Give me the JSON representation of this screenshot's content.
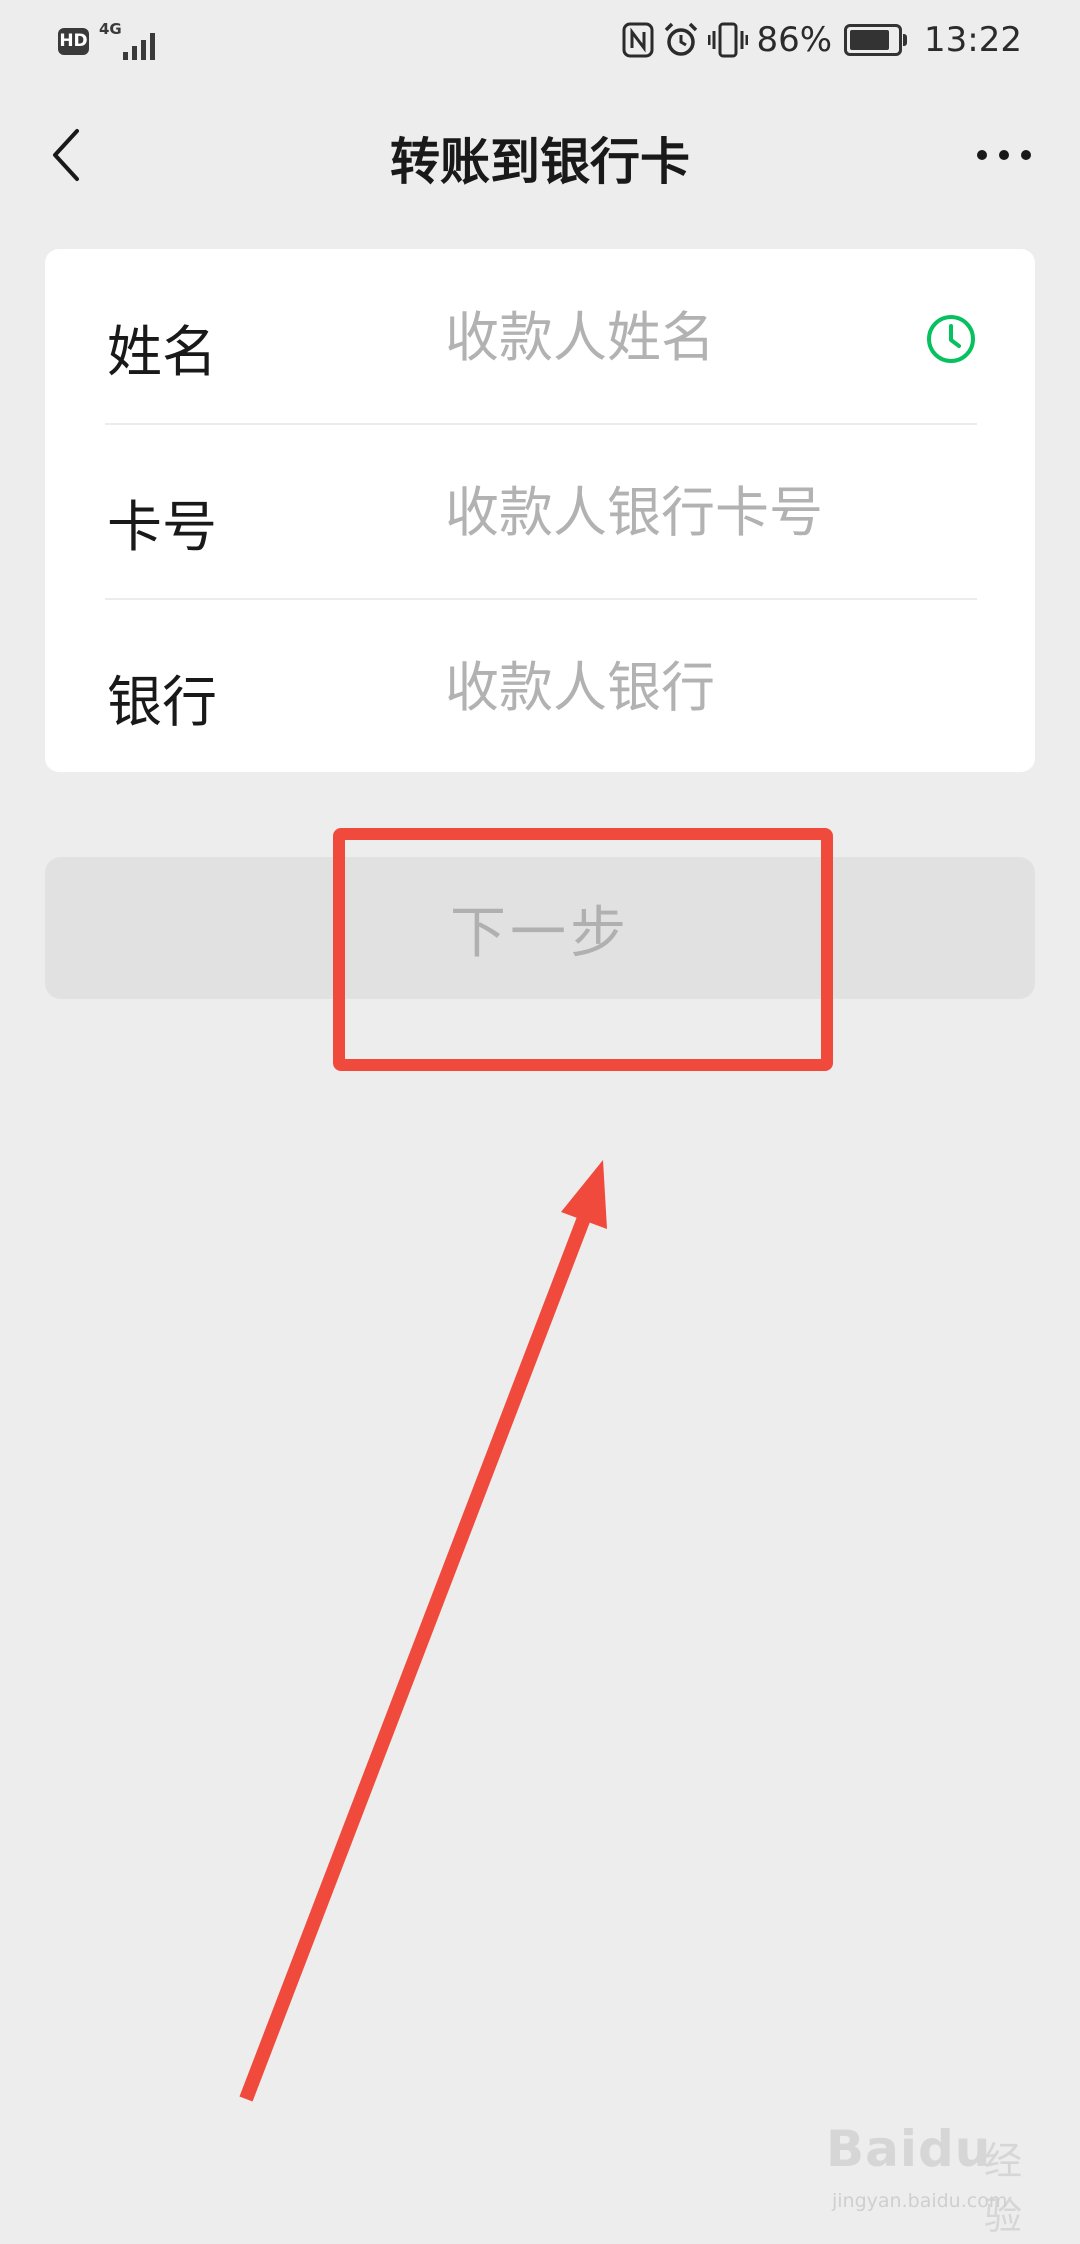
{
  "status_bar": {
    "hd_label": "HD",
    "network_label": "4G",
    "battery_percent": "86%",
    "battery_level": 0.86,
    "time": "13:22",
    "icons": [
      "hd-icon",
      "signal-icon",
      "nfc-icon",
      "alarm-icon",
      "vibrate-icon",
      "battery-icon"
    ]
  },
  "nav": {
    "title": "转账到银行卡",
    "back_icon": "chevron-left-icon",
    "more_icon": "more-dots-icon"
  },
  "form": {
    "name": {
      "label": "姓名",
      "placeholder": "收款人姓名",
      "value": ""
    },
    "card_no": {
      "label": "卡号",
      "placeholder": "收款人银行卡号",
      "value": ""
    },
    "bank": {
      "label": "银行",
      "placeholder": "收款人银行",
      "value": ""
    },
    "history_icon": "clock-icon"
  },
  "next_button": {
    "label": "下一步",
    "enabled": false
  },
  "annotation": {
    "color": "#f04a3c"
  },
  "watermark": {
    "brand": "Baidu",
    "brand_cn": "经验",
    "url": "jingyan.baidu.com"
  },
  "colors": {
    "background": "#ededed",
    "card": "#ffffff",
    "accent_green": "#07c160",
    "placeholder": "#b2b2b2",
    "button_disabled_bg": "#e1e1e1",
    "button_disabled_text": "#b0b0b0"
  }
}
